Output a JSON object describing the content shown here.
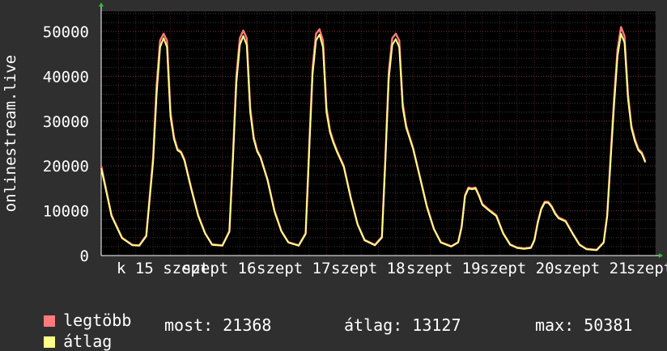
{
  "chart_data": {
    "type": "line",
    "ylabel": "onlinestream.live",
    "yticks": [
      0,
      10000,
      20000,
      30000,
      40000,
      50000
    ],
    "ylim": [
      0,
      54500
    ],
    "xlim": [
      0,
      160
    ],
    "xtick_labels": [
      "k 15 szept",
      "szept 16",
      "szept 17",
      "szept 18",
      "szept 19",
      "szept 20",
      "szept 21",
      "szept"
    ],
    "grid": true,
    "series": [
      {
        "name": "legtöbb",
        "color": "#ff7b7b",
        "points": [
          [
            0,
            20000
          ],
          [
            3,
            9000
          ],
          [
            6,
            4000
          ],
          [
            9,
            2400
          ],
          [
            11,
            2300
          ],
          [
            13,
            4500
          ],
          [
            15,
            22000
          ],
          [
            16,
            38000
          ],
          [
            17,
            48000
          ],
          [
            18,
            49500
          ],
          [
            19,
            48000
          ],
          [
            20,
            32000
          ],
          [
            21,
            26500
          ],
          [
            22,
            23800
          ],
          [
            23,
            23200
          ],
          [
            24,
            21500
          ],
          [
            26,
            15000
          ],
          [
            28,
            9000
          ],
          [
            30,
            5000
          ],
          [
            32,
            2500
          ],
          [
            35,
            2300
          ],
          [
            37,
            5500
          ],
          [
            38,
            22000
          ],
          [
            39,
            40000
          ],
          [
            40,
            48500
          ],
          [
            41,
            50200
          ],
          [
            42,
            48500
          ],
          [
            43,
            33000
          ],
          [
            44,
            26500
          ],
          [
            45,
            23500
          ],
          [
            46,
            22000
          ],
          [
            48,
            17000
          ],
          [
            50,
            10000
          ],
          [
            52,
            5500
          ],
          [
            54,
            3000
          ],
          [
            57,
            2300
          ],
          [
            59,
            5000
          ],
          [
            60,
            24000
          ],
          [
            61,
            42000
          ],
          [
            62,
            49500
          ],
          [
            63,
            50500
          ],
          [
            64,
            48000
          ],
          [
            65,
            33000
          ],
          [
            66,
            28000
          ],
          [
            67,
            25500
          ],
          [
            68,
            23500
          ],
          [
            70,
            20000
          ],
          [
            72,
            13000
          ],
          [
            74,
            7000
          ],
          [
            76,
            3500
          ],
          [
            79,
            2400
          ],
          [
            81,
            4200
          ],
          [
            82,
            22000
          ],
          [
            83,
            41000
          ],
          [
            84,
            48500
          ],
          [
            85,
            49500
          ],
          [
            86,
            48000
          ],
          [
            87,
            34000
          ],
          [
            88,
            29000
          ],
          [
            89,
            26500
          ],
          [
            90,
            24000
          ],
          [
            92,
            17500
          ],
          [
            94,
            11000
          ],
          [
            96,
            6000
          ],
          [
            98,
            3000
          ],
          [
            101,
            2100
          ],
          [
            103,
            3000
          ],
          [
            104,
            6500
          ],
          [
            105,
            13500
          ],
          [
            106,
            15200
          ],
          [
            107,
            15000
          ],
          [
            108,
            15200
          ],
          [
            109,
            13500
          ],
          [
            110,
            11500
          ],
          [
            112,
            10200
          ],
          [
            114,
            9000
          ],
          [
            116,
            5000
          ],
          [
            118,
            2500
          ],
          [
            120,
            1800
          ],
          [
            122,
            1600
          ],
          [
            124,
            1800
          ],
          [
            125,
            3500
          ],
          [
            126,
            7500
          ],
          [
            127,
            10500
          ],
          [
            128,
            12000
          ],
          [
            129,
            12000
          ],
          [
            130,
            11000
          ],
          [
            131,
            9500
          ],
          [
            132,
            8500
          ],
          [
            134,
            7800
          ],
          [
            136,
            5000
          ],
          [
            138,
            2500
          ],
          [
            140,
            1500
          ],
          [
            143,
            1300
          ],
          [
            145,
            3000
          ],
          [
            146,
            9000
          ],
          [
            147,
            22000
          ],
          [
            148,
            35000
          ],
          [
            149,
            46000
          ],
          [
            150,
            51000
          ],
          [
            151,
            49000
          ],
          [
            152,
            36000
          ],
          [
            153,
            29000
          ],
          [
            154,
            26000
          ],
          [
            155,
            23800
          ],
          [
            156,
            23000
          ],
          [
            157,
            21000
          ]
        ]
      },
      {
        "name": "átlag",
        "color": "#ffff8a",
        "points": [
          [
            0,
            19500
          ],
          [
            3,
            8800
          ],
          [
            6,
            3900
          ],
          [
            9,
            2300
          ],
          [
            11,
            2200
          ],
          [
            13,
            4300
          ],
          [
            15,
            21000
          ],
          [
            16,
            36000
          ],
          [
            17,
            46500
          ],
          [
            18,
            48500
          ],
          [
            19,
            46500
          ],
          [
            20,
            31000
          ],
          [
            21,
            26000
          ],
          [
            22,
            23500
          ],
          [
            23,
            23000
          ],
          [
            24,
            21200
          ],
          [
            26,
            14800
          ],
          [
            28,
            8800
          ],
          [
            30,
            4900
          ],
          [
            32,
            2400
          ],
          [
            35,
            2200
          ],
          [
            37,
            5300
          ],
          [
            38,
            21000
          ],
          [
            39,
            38500
          ],
          [
            40,
            47000
          ],
          [
            41,
            49000
          ],
          [
            42,
            47000
          ],
          [
            43,
            32000
          ],
          [
            44,
            26000
          ],
          [
            45,
            23200
          ],
          [
            46,
            21800
          ],
          [
            48,
            16800
          ],
          [
            50,
            9800
          ],
          [
            52,
            5400
          ],
          [
            54,
            2900
          ],
          [
            57,
            2200
          ],
          [
            59,
            4800
          ],
          [
            60,
            23000
          ],
          [
            61,
            40500
          ],
          [
            62,
            48000
          ],
          [
            63,
            49300
          ],
          [
            64,
            46500
          ],
          [
            65,
            32000
          ],
          [
            66,
            27500
          ],
          [
            67,
            25200
          ],
          [
            68,
            23200
          ],
          [
            70,
            19800
          ],
          [
            72,
            12800
          ],
          [
            74,
            6900
          ],
          [
            76,
            3400
          ],
          [
            79,
            2300
          ],
          [
            81,
            4000
          ],
          [
            82,
            21000
          ],
          [
            83,
            39500
          ],
          [
            84,
            47000
          ],
          [
            85,
            48300
          ],
          [
            86,
            46500
          ],
          [
            87,
            33000
          ],
          [
            88,
            28500
          ],
          [
            89,
            26200
          ],
          [
            90,
            23800
          ],
          [
            92,
            17300
          ],
          [
            94,
            10800
          ],
          [
            96,
            5900
          ],
          [
            98,
            2900
          ],
          [
            101,
            2000
          ],
          [
            103,
            2900
          ],
          [
            104,
            6300
          ],
          [
            105,
            13200
          ],
          [
            106,
            15000
          ],
          [
            107,
            14800
          ],
          [
            108,
            15000
          ],
          [
            109,
            13300
          ],
          [
            110,
            11300
          ],
          [
            112,
            10000
          ],
          [
            114,
            8800
          ],
          [
            116,
            4900
          ],
          [
            118,
            2400
          ],
          [
            120,
            1700
          ],
          [
            122,
            1500
          ],
          [
            124,
            1700
          ],
          [
            125,
            3400
          ],
          [
            126,
            7300
          ],
          [
            127,
            10300
          ],
          [
            128,
            11800
          ],
          [
            129,
            11800
          ],
          [
            130,
            10800
          ],
          [
            131,
            9300
          ],
          [
            132,
            8300
          ],
          [
            134,
            7600
          ],
          [
            136,
            4900
          ],
          [
            138,
            2400
          ],
          [
            140,
            1400
          ],
          [
            143,
            1200
          ],
          [
            145,
            2900
          ],
          [
            146,
            8700
          ],
          [
            147,
            21000
          ],
          [
            148,
            33500
          ],
          [
            149,
            44500
          ],
          [
            150,
            49500
          ],
          [
            151,
            47500
          ],
          [
            152,
            35000
          ],
          [
            153,
            28500
          ],
          [
            154,
            25500
          ],
          [
            155,
            23500
          ],
          [
            156,
            22700
          ],
          [
            157,
            20800
          ]
        ]
      }
    ],
    "legend": [
      {
        "label": "legtöbb",
        "color": "#ff7b7b"
      },
      {
        "label": "átlag",
        "color": "#ffff8a"
      }
    ],
    "stats": {
      "most": "most: 21368",
      "atlag": "átlag: 13127",
      "max": "max: 50381"
    }
  }
}
